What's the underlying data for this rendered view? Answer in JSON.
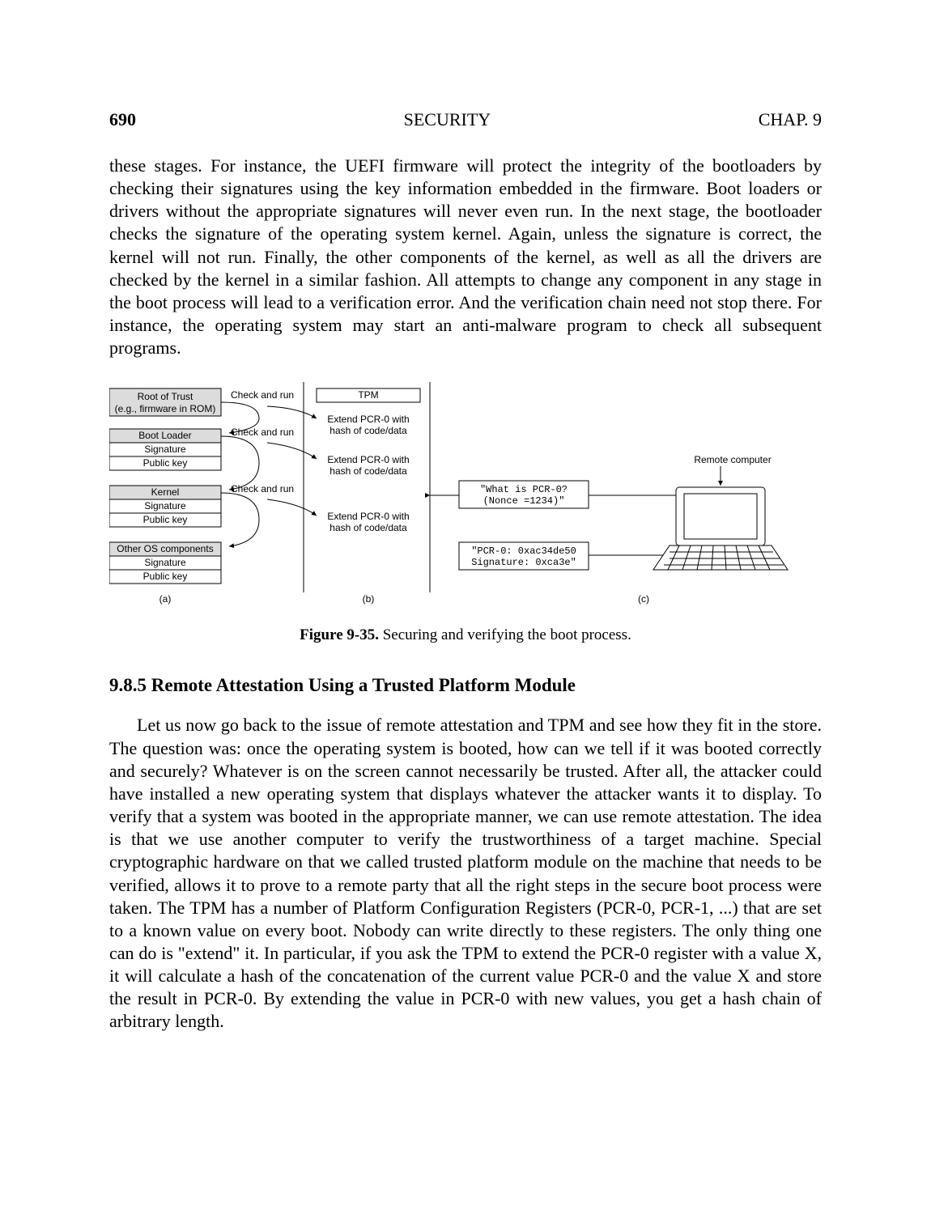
{
  "header": {
    "page_number": "690",
    "title": "SECURITY",
    "chapter": "CHAP.  9"
  },
  "paragraph1": "these stages. For instance, the UEFI firmware will protect the integrity of the boot­loaders by checking their signatures using the key information embedded in the firmware. Boot loaders or drivers without the appropriate signatures will never even run. In the next stage, the bootloader checks the signature of the operating system kernel. Again, unless the signature is correct, the kernel will not run. Final­ly, the other components of the kernel, as well as all the drivers are checked by the kernel in a similar fashion. All attempts to change any component in any stage in the boot process will lead to a verification error. And the verification chain need not stop there. For instance, the operating system may start an anti-malware pro­gram to check all subsequent programs.",
  "figure": {
    "col_a": {
      "root_of_trust": "Root of Trust",
      "root_of_trust_sub": "(e.g., firmware in ROM)",
      "boot_loader": "Boot Loader",
      "kernel": "Kernel",
      "other_os": "Other OS components",
      "signature": "Signature",
      "public_key": "Public key",
      "check_and_run": "Check and run",
      "label": "(a)"
    },
    "col_b": {
      "tpm": "TPM",
      "extend1": "Extend PCR-0 with",
      "extend2": "hash of code/data",
      "label": "(b)"
    },
    "col_c": {
      "remote_computer": "Remote computer",
      "msg1a": "\"What is PCR-0?",
      "msg1b": "(Nonce =1234)\"",
      "msg2a": "\"PCR-0: 0xac34de50",
      "msg2b": "Signature: 0xca3e\"",
      "label": "(c)"
    },
    "caption_label": "Figure 9-35.",
    "caption_text": "  Securing and verifying the boot process."
  },
  "section_heading": "9.8.5  Remote Attestation Using a Trusted Platform Module",
  "paragraph2": "Let us now go back to the issue of remote attestation and TPM and see how they fit in the store. The question was: once the operating system is booted, how can we tell if it was booted correctly and securely?  Whatever is on the screen can­not necessarily be trusted. After all, the attacker could have installed a new operat­ing system that displays whatever the attacker wants it to display. To verify that a system was booted in the appropriate manner, we can use remote attestation. The idea is that we use another computer to verify the trustworthiness of a target machine.  Special cryptographic hardware on that we called trusted platform mod­ule on the machine that needs to be verified, allows it to prove to a remote party that all the right steps in the secure boot process were taken. The TPM has a num­ber of Platform Configuration Registers (PCR-0, PCR-1, ...) that are set to a known value on every boot. Nobody can write directly to these registers. The only thing one can do is \"extend\" it. In particular, if you ask the TPM to extend the PCR-0 register with a value X, it will calculate a hash of the concatenation of the current value PCR-0 and the value X and store the result in PCR-0. By extending the value in PCR-0 with new values, you get a hash chain of arbitrary length."
}
